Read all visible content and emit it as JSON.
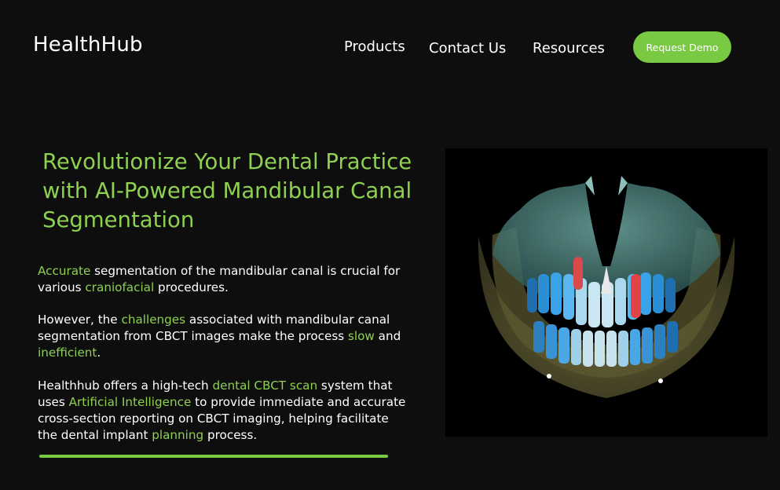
{
  "header": {
    "logo": "HealthHub",
    "nav": [
      "Products",
      "Contact Us",
      "Resources"
    ],
    "cta_label": "Request Demo"
  },
  "hero": {
    "headline": "Revolutionize Your Dental Practice with AI-Powered Mandibular Canal Segmentation",
    "paragraphs": [
      [
        {
          "text": "Accurate",
          "hl": true
        },
        {
          "text": " segmentation of the mandibular canal is crucial for various ",
          "hl": false
        },
        {
          "text": "craniofacial",
          "hl": true
        },
        {
          "text": " procedures.",
          "hl": false
        }
      ],
      [
        {
          "text": "However, the ",
          "hl": false
        },
        {
          "text": "challenges",
          "hl": true
        },
        {
          "text": " associated with mandibular canal segmentation from CBCT images make the process ",
          "hl": false
        },
        {
          "text": "slow",
          "hl": true
        },
        {
          "text": " and ",
          "hl": false
        },
        {
          "text": "inefficient",
          "hl": true
        },
        {
          "text": ".",
          "hl": false
        }
      ],
      [
        {
          "text": "Healthhub offers a high-tech ",
          "hl": false
        },
        {
          "text": "dental CBCT scan",
          "hl": true
        },
        {
          "text": " system that uses ",
          "hl": false
        },
        {
          "text": "Artificial Intelligence",
          "hl": true
        },
        {
          "text": " to provide immediate and accurate cross-section reporting on CBCT imaging, helping facilitate the dental implant ",
          "hl": false
        },
        {
          "text": "planning",
          "hl": true
        },
        {
          "text": " process.",
          "hl": false
        }
      ]
    ]
  },
  "colors": {
    "accent": "#8ed151",
    "button": "#7ac943",
    "background": "#0e0e0e"
  }
}
